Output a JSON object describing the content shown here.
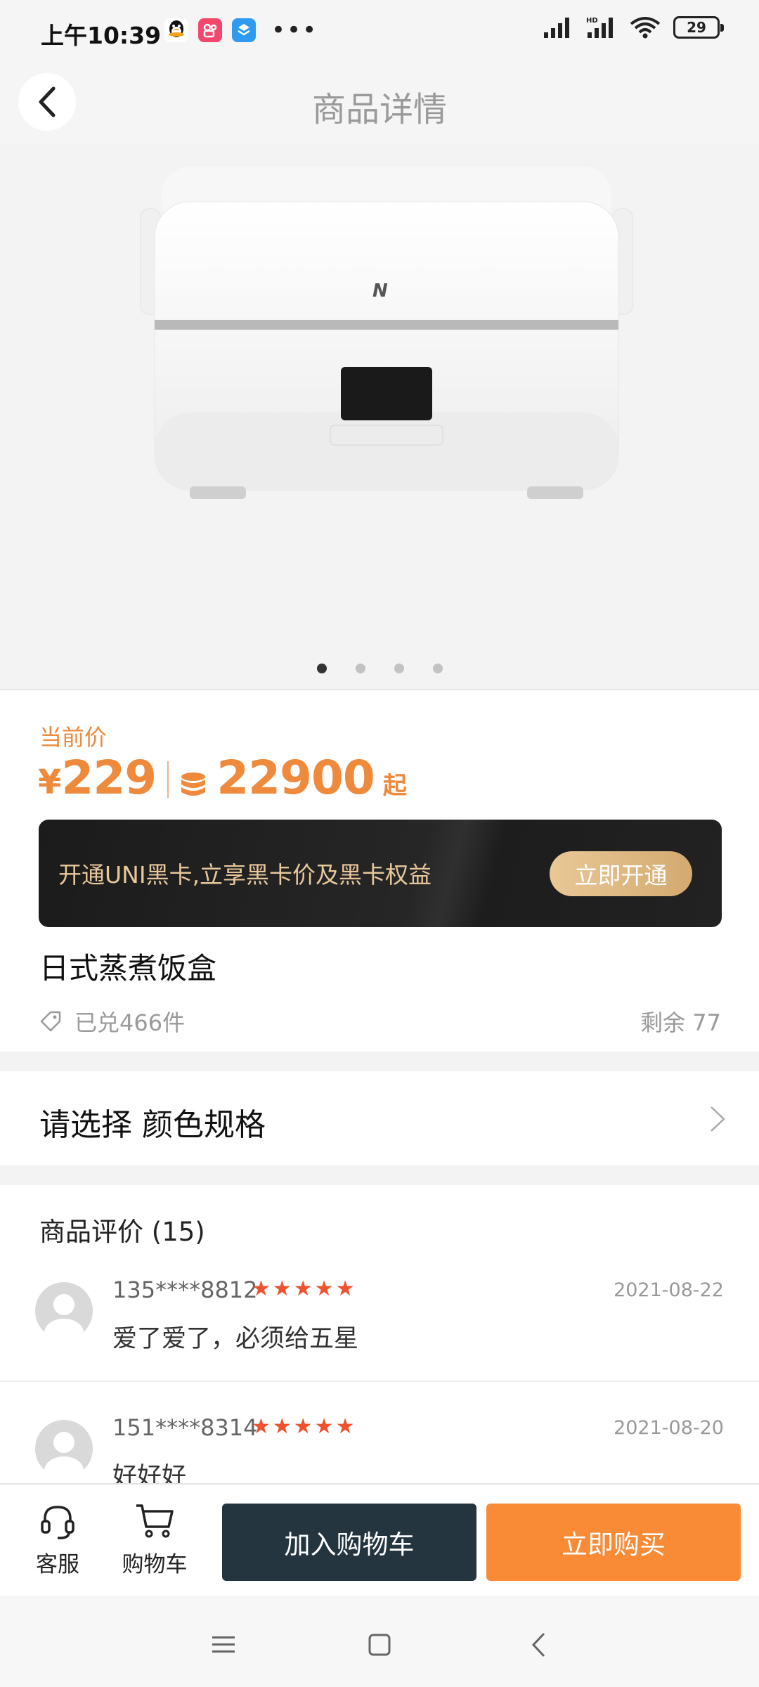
{
  "status_bar": {
    "time": "上午10:39",
    "app_icons": [
      "qq-icon",
      "kuaishou-icon",
      "map-app-icon"
    ],
    "more": "•••",
    "battery": "29"
  },
  "header": {
    "title": "商品详情"
  },
  "gallery": {
    "image_count": 4,
    "active_index": 0
  },
  "price": {
    "label": "当前价",
    "currency": "¥",
    "amount": "229",
    "points": "22900",
    "from": "起",
    "accent_color": "#ef8a3c"
  },
  "vip": {
    "text": "开通UNI黑卡,立享黑卡价及黑卡权益",
    "button": "立即开通"
  },
  "product": {
    "name": "日式蒸煮饭盒",
    "redeemed": "已兑466件",
    "remaining": "剩余 77"
  },
  "spec": {
    "label": "请选择 颜色规格"
  },
  "reviews": {
    "title": "商品评价 (15)",
    "items": [
      {
        "user": "135****8812",
        "stars": "★★★★★",
        "date": "2021-08-22",
        "text": "爱了爱了，必须给五星"
      },
      {
        "user": "151****8314",
        "stars": "★★★★★",
        "date": "2021-08-20",
        "text": "好好好"
      }
    ]
  },
  "bottom_bar": {
    "service": "客服",
    "cart": "购物车",
    "add_to_cart": "加入购物车",
    "buy_now": "立即购买"
  }
}
